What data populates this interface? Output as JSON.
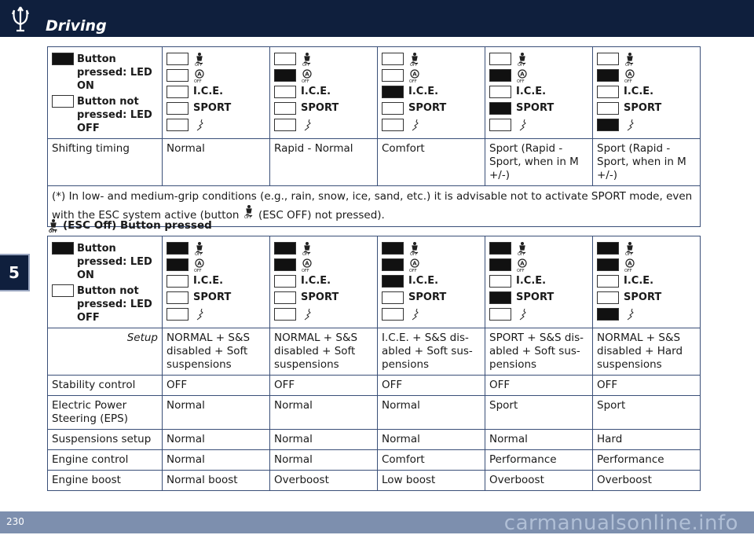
{
  "header": {
    "section_title": "Driving"
  },
  "chapter": "5",
  "footer": {
    "page_number": "230",
    "watermark": "carmanualsonline.info"
  },
  "legend": {
    "led_on": "Button pressed: LED ON",
    "led_off": "Button not pressed: LED OFF"
  },
  "labels": {
    "ice": "I.C.E.",
    "sport": "SPORT"
  },
  "table1": {
    "leds": [
      {
        "esc": false,
        "asr": false,
        "ice": false,
        "sport": false,
        "susp": false
      },
      {
        "esc": false,
        "asr": true,
        "ice": false,
        "sport": false,
        "susp": false
      },
      {
        "esc": false,
        "asr": false,
        "ice": true,
        "sport": false,
        "susp": false
      },
      {
        "esc": false,
        "asr": true,
        "ice": false,
        "sport": true,
        "susp": false
      },
      {
        "esc": false,
        "asr": true,
        "ice": false,
        "sport": false,
        "susp": true
      }
    ],
    "shifting_label": "Shifting timing",
    "shifting": [
      "Normal",
      "Rapid - Normal",
      "Comfort",
      "Sport (Rapid - Sport, when in M +/-)",
      "Sport (Rapid - Sport, when in M +/-)"
    ],
    "note_part1": "(*) In low- and medium-grip conditions (e.g., rain, snow, ice, sand, etc.) it is advisable not to activate SPORT mode, even with the ESC system active (button",
    "note_part2": "(ESC OFF) not pressed)."
  },
  "esc_heading": "(ESC Off) Button pressed",
  "table2": {
    "leds": [
      {
        "esc": true,
        "asr": true,
        "ice": false,
        "sport": false,
        "susp": false
      },
      {
        "esc": true,
        "asr": true,
        "ice": false,
        "sport": false,
        "susp": false
      },
      {
        "esc": true,
        "asr": true,
        "ice": true,
        "sport": false,
        "susp": false
      },
      {
        "esc": true,
        "asr": true,
        "ice": false,
        "sport": true,
        "susp": false
      },
      {
        "esc": true,
        "asr": true,
        "ice": false,
        "sport": false,
        "susp": true
      }
    ],
    "rows": [
      {
        "label": "Setup",
        "values": [
          "NORMAL + S&S disabled + Soft suspensions",
          "NORMAL + S&S disabled + Soft suspensions",
          "I.C.E. + S&S dis-abled + Soft sus-pensions",
          "SPORT + S&S dis-abled + Soft sus-pensions",
          "NORMAL + S&S disabled + Hard suspensions"
        ]
      },
      {
        "label": "Stability control",
        "values": [
          "OFF",
          "OFF",
          "OFF",
          "OFF",
          "OFF"
        ]
      },
      {
        "label": "Electric Power Steering (EPS)",
        "values": [
          "Normal",
          "Normal",
          "Normal",
          "Sport",
          "Sport"
        ]
      },
      {
        "label": "Suspensions setup",
        "values": [
          "Normal",
          "Normal",
          "Normal",
          "Normal",
          "Hard"
        ]
      },
      {
        "label": "Engine control",
        "values": [
          "Normal",
          "Normal",
          "Comfort",
          "Performance",
          "Performance"
        ]
      },
      {
        "label": "Engine boost",
        "values": [
          "Normal boost",
          "Overboost",
          "Low boost",
          "Overboost",
          "Overboost"
        ]
      }
    ]
  },
  "icons": [
    "esc-off-icon",
    "asr-off-icon",
    "suspension-icon",
    "trident-logo-icon"
  ]
}
